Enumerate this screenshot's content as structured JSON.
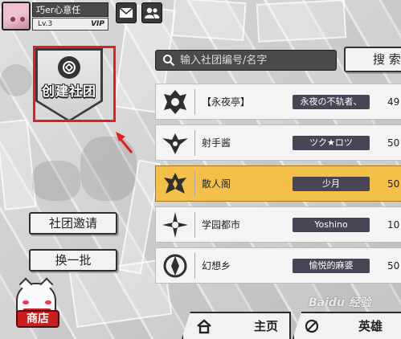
{
  "user": {
    "name": "巧er心意任",
    "level": "Lv.3",
    "vip": "VIP"
  },
  "icons": {
    "mail": "mail-icon",
    "friends": "friends-icon",
    "search": "search-icon",
    "home": "home-icon",
    "hero": "hero-icon"
  },
  "create_guild": {
    "label": "创建社团"
  },
  "left_buttons": {
    "invite": "社团邀请",
    "refresh": "换一批"
  },
  "shop": {
    "label": "商店"
  },
  "search": {
    "placeholder": "输入社团编号/名字",
    "value": "",
    "button": "搜 索"
  },
  "guilds": [
    {
      "name": "【永夜亭】",
      "leader": "永夜の不轨者、",
      "count": "49",
      "selected": false
    },
    {
      "name": "射手酱",
      "leader": "ツク★ロツ",
      "count": "50",
      "selected": false
    },
    {
      "name": "散人阁",
      "leader": "少月",
      "count": "50",
      "selected": true
    },
    {
      "name": "学园都市",
      "leader": "Yoshino",
      "count": "10",
      "selected": false
    },
    {
      "name": "幻想乡",
      "leader": "愉悦的麻婆",
      "count": "50",
      "selected": false
    }
  ],
  "bottom_nav": {
    "home": "主页",
    "hero": "英雄"
  },
  "watermark": "Baidu 经验",
  "colors": {
    "highlight": "#e02020",
    "selected_row": "#f5c04a",
    "leader_badge": "#4a4556",
    "shop_red": "#c91e1e"
  }
}
